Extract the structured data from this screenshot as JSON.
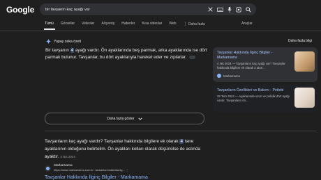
{
  "logo": "Google",
  "search": {
    "query": "bir tavşanın kaç ayağı var"
  },
  "tabs": [
    "Tümü",
    "Görseller",
    "Videolar",
    "Alışveriş",
    "Haberler",
    "Kısa videolar",
    "Web",
    "Daha fazla"
  ],
  "tools_label": "Araçlar",
  "ai": {
    "label": "Yapay zeka özeti",
    "more_label": "Daha fazla bilgi",
    "text_before": "Bir tavşanın ",
    "highlight": "4",
    "text_after": " ayağı vardır. Ön ayaklarında beş parmak, arka ayaklarında ise dört parmak bulunur. Tavşanlar, bu dört ayaklarıyla hareket eder ve zıplarlar.",
    "show_more": "Daha fazla göster"
  },
  "cards": [
    {
      "title": "Tavşanlar Hakkında İlginç Bilgiler - Markamama",
      "snippet": "4 Nis 2024 — Tavşanların kaç ayağı var? Tavşanlar hakkında bilgilere ek olarak 4 tane...",
      "source": "Markamama"
    },
    {
      "title": "Tavşanların Özellikleri ve Bakımı - Petlebi",
      "snippet": "29 Tem 2024 — Ayaklarında uzun ve pofidik dört ayağı vardır. Tavşanların ön..."
    }
  ],
  "result": {
    "text_before": "Tavşanların kaç ayağı vardır? Tavşanlar hakkında bilgilere ek olarak ",
    "highlight": "4",
    "text_after": " tane ayaklarının olduğunu belirtelim. Ön ayakları kolları olarak düşünülse de aslında ayaktır.",
    "date": "4 Nis 2024",
    "site": "Markamama",
    "url": "https://www.markamama.com.tr › tavsanlar-hakkinda-ilg...",
    "title": "Tavşanlar Hakkında İlginç Bilgiler - Markamama"
  },
  "colors": {
    "background": "#1f1f1f",
    "link": "#8ab4f8",
    "highlight": "#3b4a6b"
  }
}
